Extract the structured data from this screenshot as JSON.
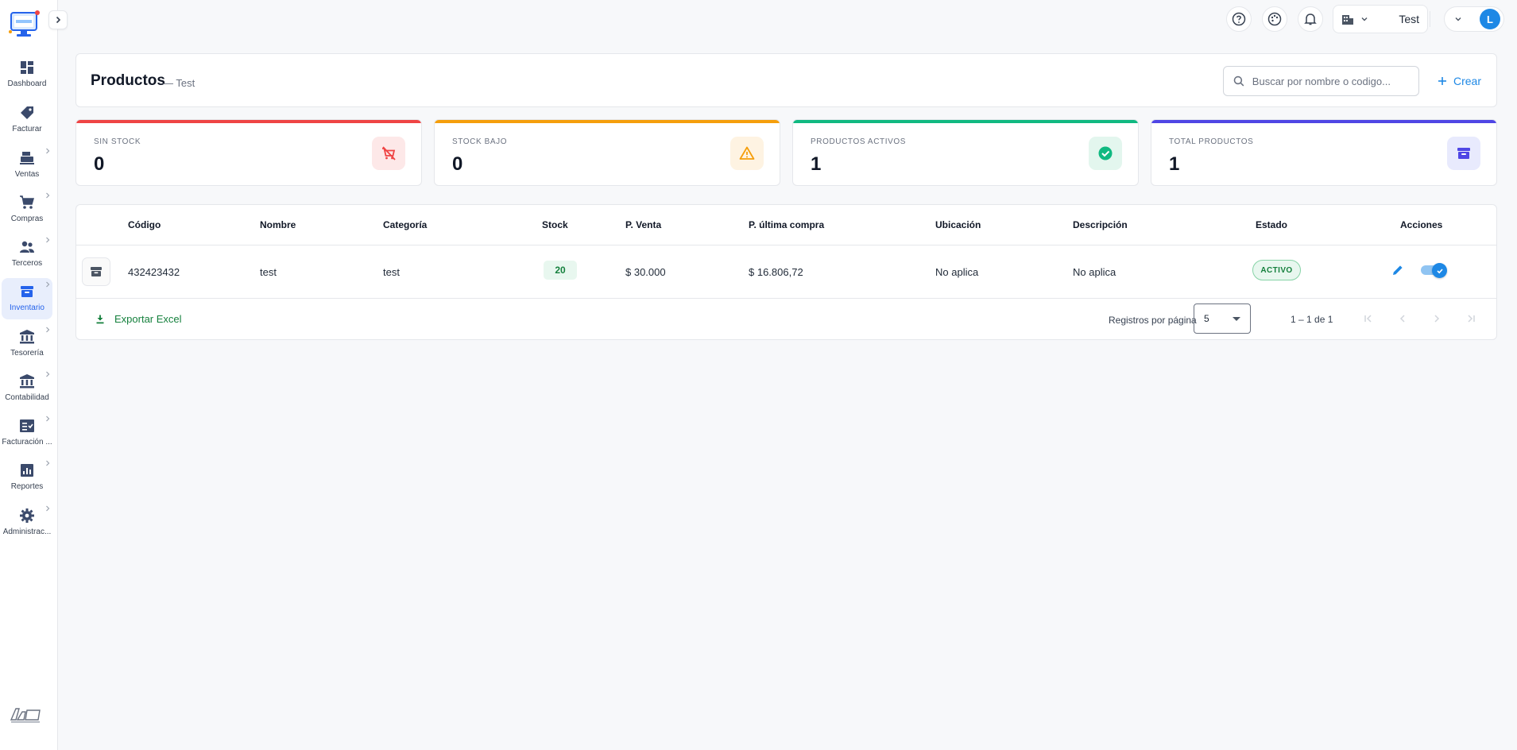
{
  "sidebar": {
    "items": [
      {
        "label": "Dashboard",
        "icon": "dashboard-icon",
        "has_children": false,
        "active": false
      },
      {
        "label": "Facturar",
        "icon": "tag-icon",
        "has_children": false,
        "active": false
      },
      {
        "label": "Ventas",
        "icon": "cash-register-icon",
        "has_children": true,
        "active": false
      },
      {
        "label": "Compras",
        "icon": "cart-icon",
        "has_children": true,
        "active": false
      },
      {
        "label": "Terceros",
        "icon": "people-icon",
        "has_children": true,
        "active": false
      },
      {
        "label": "Inventario",
        "icon": "archive-icon",
        "has_children": true,
        "active": true
      },
      {
        "label": "Tesorería",
        "icon": "bank-icon",
        "has_children": true,
        "active": false
      },
      {
        "label": "Contabilidad",
        "icon": "bank-icon",
        "has_children": true,
        "active": false
      },
      {
        "label": "Facturación ...",
        "icon": "checklist-icon",
        "has_children": true,
        "active": false
      },
      {
        "label": "Reportes",
        "icon": "bar-chart-icon",
        "has_children": true,
        "active": false
      },
      {
        "label": "Administrac...",
        "icon": "gear-icon",
        "has_children": true,
        "active": false
      }
    ]
  },
  "topbar": {
    "company_name": "Test",
    "avatar_initial": "L"
  },
  "header": {
    "title": "Productos",
    "subtitle": "— Test",
    "search_placeholder": "Buscar por nombre o codigo...",
    "create_label": "Crear"
  },
  "stats": [
    {
      "label": "SIN STOCK",
      "value": "0",
      "color": "#ef4444",
      "icon": "no-cart-icon",
      "icon_bg": "#fde8e8"
    },
    {
      "label": "STOCK BAJO",
      "value": "0",
      "color": "#f59e0b",
      "icon": "warning-icon",
      "icon_bg": "#fef3e2"
    },
    {
      "label": "PRODUCTOS ACTIVOS",
      "value": "1",
      "color": "#10b981",
      "icon": "check-circle-icon",
      "icon_bg": "#e3f6ee"
    },
    {
      "label": "TOTAL PRODUCTOS",
      "value": "1",
      "color": "#4f46e5",
      "icon": "archive-icon",
      "icon_bg": "#e8eafd"
    }
  ],
  "table": {
    "columns": [
      "Código",
      "Nombre",
      "Categoría",
      "Stock",
      "P. Venta",
      "P. última compra",
      "Ubicación",
      "Descripción",
      "Estado",
      "Acciones"
    ],
    "rows": [
      {
        "codigo": "432423432",
        "nombre": "test",
        "categoria": "test",
        "stock": "20",
        "p_venta": "$ 30.000",
        "p_ultima_compra": "$ 16.806,72",
        "ubicacion": "No aplica",
        "descripcion": "No aplica",
        "estado": "ACTIVO",
        "enabled": true
      }
    ],
    "export_label": "Exportar Excel",
    "rows_per_page_label": "Registros por página",
    "rows_per_page": "5",
    "range_label": "1 – 1 de 1"
  },
  "colors": {
    "accent": "#1e88e5",
    "success": "#15803d",
    "sidebar_active_bg": "#e8eefc"
  }
}
